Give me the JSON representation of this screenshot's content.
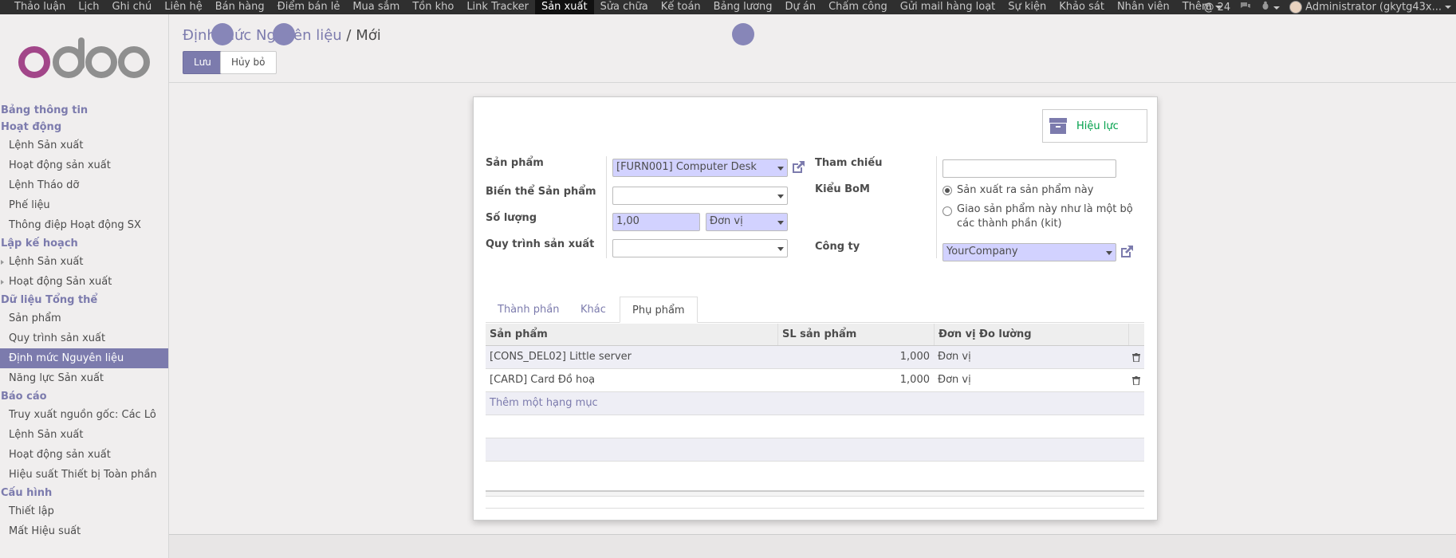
{
  "topbar": {
    "menu": [
      "Thảo luận",
      "Lịch",
      "Ghi chú",
      "Liên hệ",
      "Bán hàng",
      "Điểm bán lẻ",
      "Mua sắm",
      "Tồn kho",
      "Link Tracker",
      "Sản xuất",
      "Sửa chữa",
      "Kế toán",
      "Bảng lương",
      "Dự án",
      "Chấm công",
      "Gửi mail hàng loạt",
      "Sự kiện",
      "Khảo sát",
      "Nhân viên"
    ],
    "more": "Thêm",
    "mentions": "@ 24",
    "user": "Administrator (gkytg43x..."
  },
  "colors": {
    "primary": "#7c7bad",
    "topbar": "#2f2f2f",
    "required_bg": "#d2d2ff",
    "success": "#00a04a"
  },
  "sidebar": {
    "sections": [
      {
        "title": "Bảng thông tin",
        "items": []
      },
      {
        "title": "Hoạt động",
        "items": [
          "Lệnh Sản xuất",
          "Hoạt động sản xuất",
          "Lệnh Tháo dỡ",
          "Phế liệu",
          "Thông điệp Hoạt động SX"
        ]
      },
      {
        "title": "Lập kế hoạch",
        "items": [
          "Lệnh Sản xuất",
          "Hoạt động Sản xuất"
        ]
      },
      {
        "title": "Dữ liệu Tổng thể",
        "items": [
          "Sản phẩm",
          "Quy trình sản xuất",
          "Định mức Nguyên liệu",
          "Năng lực Sản xuất"
        ]
      },
      {
        "title": "Báo cáo",
        "items": [
          "Truy xuất nguồn gốc: Các Lô",
          "Lệnh Sản xuất",
          "Hoạt động sản xuất",
          "Hiệu suất Thiết bị Toàn phần"
        ]
      },
      {
        "title": "Cấu hình",
        "items": [
          "Thiết lập",
          "Mất Hiệu suất"
        ]
      }
    ]
  },
  "breadcrumb": {
    "parent": "Định mức Nguyên liệu",
    "separator": "/",
    "current": "Mới"
  },
  "buttons": {
    "save": "Lưu",
    "discard": "Hủy bỏ"
  },
  "smart_button": {
    "label": "Hiệu lực"
  },
  "form": {
    "product_label": "Sản phẩm",
    "product_value": "[FURN001] Computer Desk",
    "variant_label": "Biến thể Sản phẩm",
    "variant_value": "",
    "qty_label": "Số lượng",
    "qty_value": "1,00",
    "uom_value": "Đơn vị",
    "routing_label": "Quy trình sản xuất",
    "routing_value": "",
    "ref_label": "Tham chiếu",
    "ref_value": "",
    "bom_type_label": "Kiểu BoM",
    "bom_type_opt1": "Sản xuất ra sản phẩm này",
    "bom_type_opt2_line1": "Giao sản phẩm này như là một bộ",
    "bom_type_opt2_line2": "các thành phần (kit)",
    "company_label": "Công ty",
    "company_value": "YourCompany"
  },
  "tabs": [
    "Thành phần",
    "Khác",
    "Phụ phẩm"
  ],
  "table": {
    "columns": [
      "Sản phẩm",
      "SL sản phẩm",
      "Đơn vị Đo lường"
    ],
    "rows": [
      {
        "product": "[CONS_DEL02] Little server",
        "qty": "1,000",
        "uom": "Đơn vị"
      },
      {
        "product": "[CARD] Card Đồ hoạ",
        "qty": "1,000",
        "uom": "Đơn vị"
      }
    ],
    "add_line": "Thêm một hạng mục"
  }
}
